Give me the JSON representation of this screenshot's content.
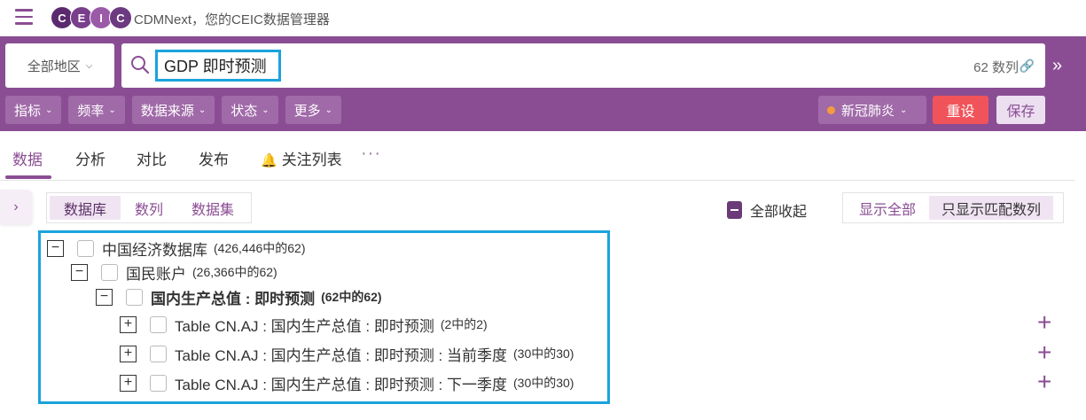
{
  "header": {
    "logo_letters": [
      "C",
      "E",
      "I",
      "C"
    ],
    "title": "CDMNext，您的CEIC数据管理器"
  },
  "search": {
    "region_label": "全部地区",
    "query": "GDP 即时预测",
    "series_count": "62 数列"
  },
  "filters": [
    {
      "label": "指标"
    },
    {
      "label": "频率"
    },
    {
      "label": "数据来源"
    },
    {
      "label": "状态"
    },
    {
      "label": "更多"
    }
  ],
  "covid": {
    "label": "新冠肺炎"
  },
  "actions": {
    "reset": "重设",
    "save": "保存"
  },
  "tabs": [
    {
      "label": "数据",
      "active": true
    },
    {
      "label": "分析"
    },
    {
      "label": "对比"
    },
    {
      "label": "发布"
    },
    {
      "label": "关注列表"
    }
  ],
  "view_toggle": [
    {
      "label": "数据库",
      "active": true
    },
    {
      "label": "数列"
    },
    {
      "label": "数据集"
    }
  ],
  "collapse_all": "全部收起",
  "show_toggle": [
    {
      "label": "显示全部"
    },
    {
      "label": "只显示匹配数列",
      "active": true
    }
  ],
  "tree": [
    {
      "label": "中国经济数据库",
      "count": "(426,446中的62)",
      "expander": "minus",
      "level": 0
    },
    {
      "label": "国民账户",
      "count": "(26,366中的62)",
      "expander": "minus",
      "level": 1
    },
    {
      "label": "国内生产总值 : 即时预测",
      "count": "(62中的62)",
      "expander": "minus",
      "level": 2,
      "bold": true
    },
    {
      "label": "Table CN.AJ : 国内生产总值 : 即时预测",
      "count": "(2中的2)",
      "expander": "plus",
      "level": 3
    },
    {
      "label": "Table CN.AJ : 国内生产总值 : 即时预测 : 当前季度",
      "count": "(30中的30)",
      "expander": "plus",
      "level": 3
    },
    {
      "label": "Table CN.AJ : 国内生产总值 : 即时预测 : 下一季度",
      "count": "(30中的30)",
      "expander": "plus",
      "level": 3
    }
  ],
  "colors": {
    "brand_purple": "#8a4d93",
    "highlight_blue": "#1aa3dc",
    "reset_red": "#f0545a"
  }
}
